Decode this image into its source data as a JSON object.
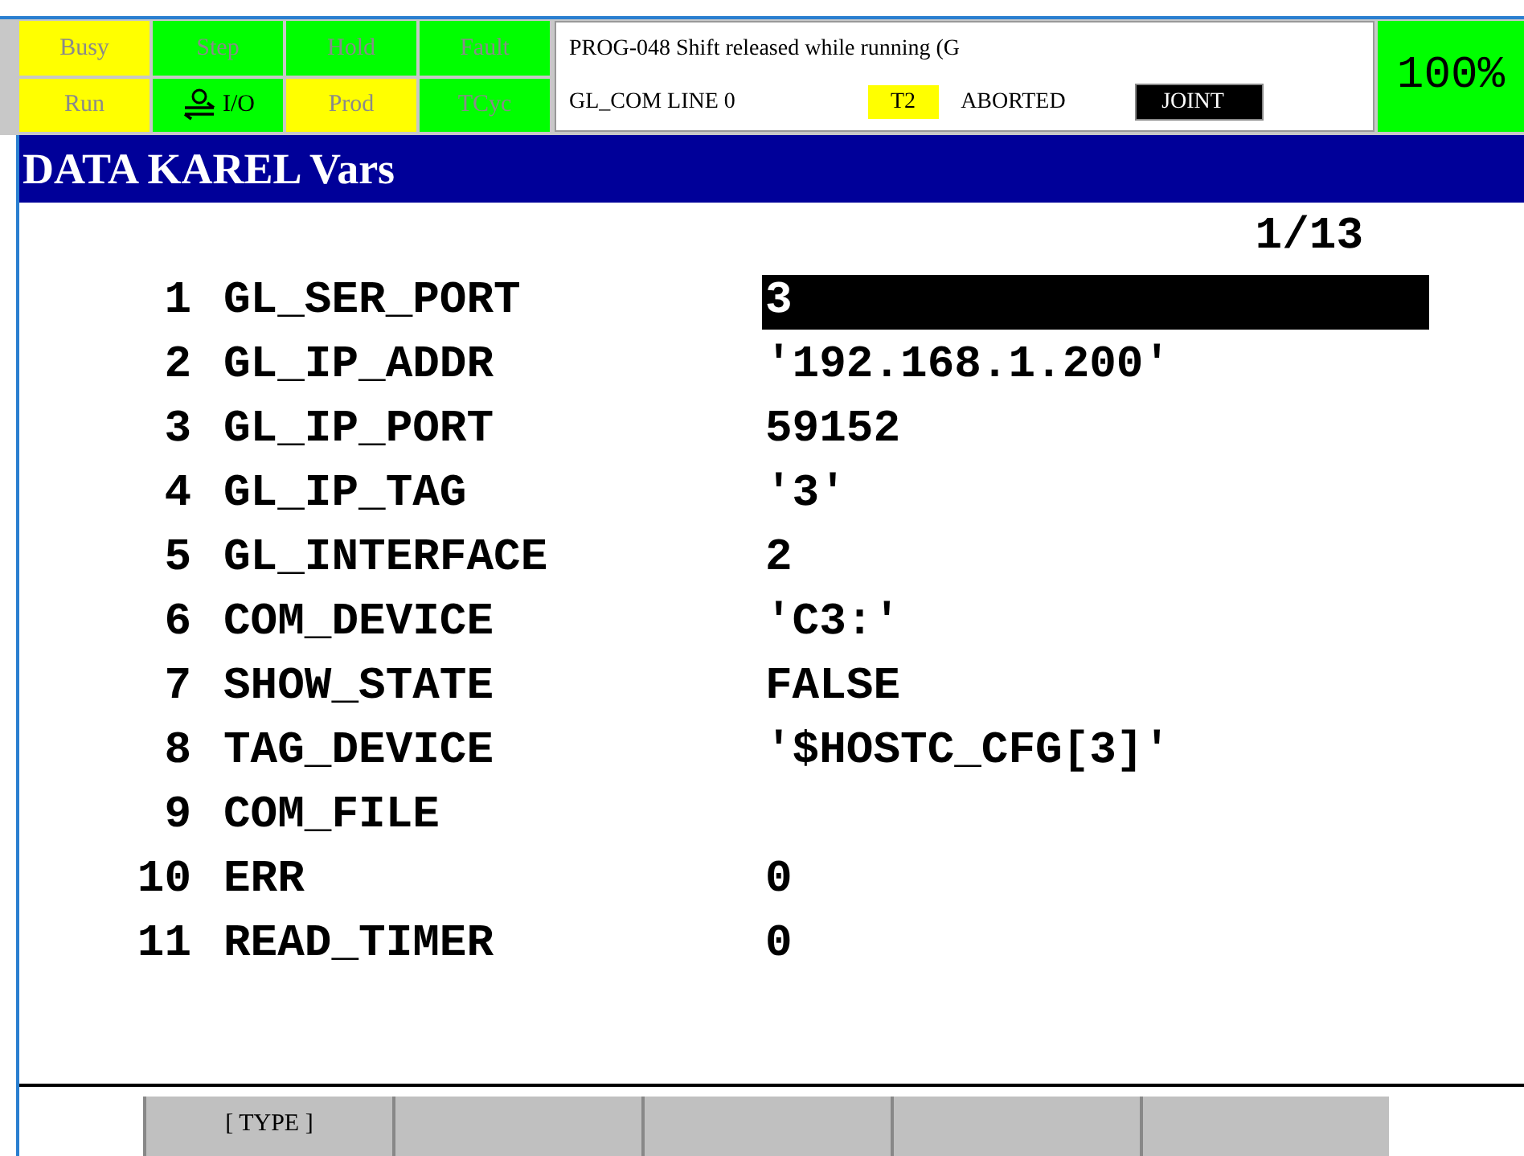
{
  "status_indicators": [
    {
      "label": "Busy",
      "color": "#ffff00",
      "kind": "text"
    },
    {
      "label": "Step",
      "color": "#00ff00",
      "kind": "text"
    },
    {
      "label": "Hold",
      "color": "#00ff00",
      "kind": "text"
    },
    {
      "label": "Fault",
      "color": "#00ff00",
      "kind": "text"
    },
    {
      "label": "Run",
      "color": "#ffff00",
      "kind": "text"
    },
    {
      "label": "I/O",
      "color": "#00ff00",
      "kind": "io"
    },
    {
      "label": "Prod",
      "color": "#ffff00",
      "kind": "text"
    },
    {
      "label": "TCyc",
      "color": "#00ff00",
      "kind": "text"
    }
  ],
  "message": {
    "alarm": "PROG-048 Shift released while running (G",
    "program": "GL_COM LINE 0",
    "mode": "T2",
    "state": "ABORTED",
    "coord": "JOINT"
  },
  "override": "100%",
  "title": "DATA KAREL Vars",
  "page": "1/13",
  "variables": [
    {
      "index": "1",
      "name": "GL_SER_PORT",
      "value": "3",
      "selected": true
    },
    {
      "index": "2",
      "name": "GL_IP_ADDR",
      "value": "'192.168.1.200'",
      "selected": false
    },
    {
      "index": "3",
      "name": "GL_IP_PORT",
      "value": "59152",
      "selected": false
    },
    {
      "index": "4",
      "name": "GL_IP_TAG",
      "value": "'3'",
      "selected": false
    },
    {
      "index": "5",
      "name": "GL_INTERFACE",
      "value": "2",
      "selected": false
    },
    {
      "index": "6",
      "name": "COM_DEVICE",
      "value": "'C3:'",
      "selected": false
    },
    {
      "index": "7",
      "name": "SHOW_STATE",
      "value": "FALSE",
      "selected": false
    },
    {
      "index": "8",
      "name": "TAG_DEVICE",
      "value": "'$HOSTC_CFG[3]'",
      "selected": false
    },
    {
      "index": "9",
      "name": "COM_FILE",
      "selected": false
    },
    {
      "index": "10",
      "name": "ERR",
      "value": "0",
      "selected": false
    },
    {
      "index": "11",
      "name": "READ_TIMER",
      "value": "0",
      "selected": false
    }
  ],
  "function_keys": [
    {
      "kind": "labeled",
      "label": "[ TYPE ]"
    },
    {
      "kind": "blank"
    },
    {
      "kind": "blank"
    },
    {
      "kind": "blank"
    },
    {
      "kind": "blank"
    }
  ]
}
